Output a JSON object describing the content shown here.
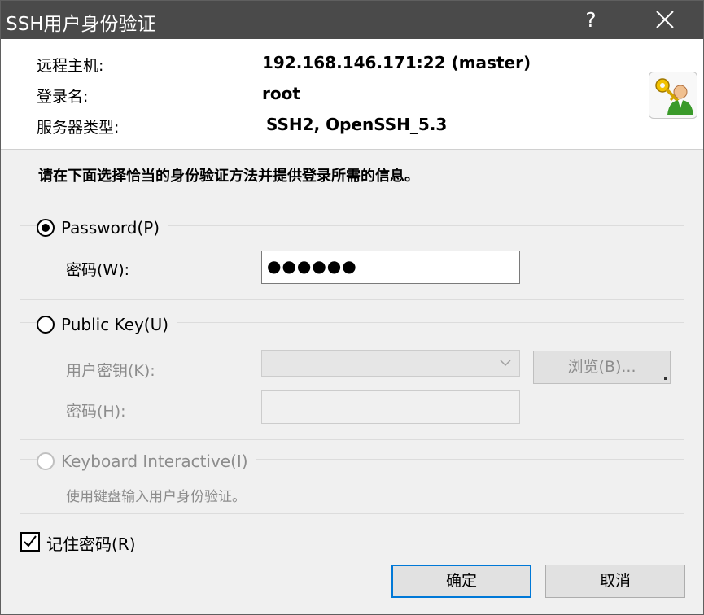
{
  "window": {
    "title": "SSH用户身份验证",
    "help_label": "?",
    "close_icon": "close-icon"
  },
  "connection": {
    "host_label": "远程主机:",
    "host_value": "192.168.146.171:22 (master)",
    "login_label": "登录名:",
    "login_value": "root",
    "server_type_label": "服务器类型:",
    "server_type_value": "SSH2, OpenSSH_5.3",
    "icon": "user-key-icon"
  },
  "instruction": "请在下面选择恰当的身份验证方法并提供登录所需的信息。",
  "password_method": {
    "label": "Password(P)",
    "selected": true,
    "field_label": "密码(W):",
    "value": "●●●●●●"
  },
  "public_key_method": {
    "label": "Public Key(U)",
    "selected": false,
    "user_key_label": "用户密钥(K):",
    "user_key_value": "",
    "browse_label": "浏览(B)...",
    "passphrase_label": "密码(H):",
    "passphrase_value": ""
  },
  "keyboard_method": {
    "label": "Keyboard Interactive(I)",
    "selected": false,
    "description": "使用键盘输入用户身份验证。"
  },
  "remember_password": {
    "label": "记住密码(R)",
    "checked": true
  },
  "buttons": {
    "ok": "确定",
    "cancel": "取消"
  },
  "colors": {
    "titlebar": "#4a4a4a",
    "accent": "#0078d7",
    "disabled_text": "#8c8c8c"
  }
}
